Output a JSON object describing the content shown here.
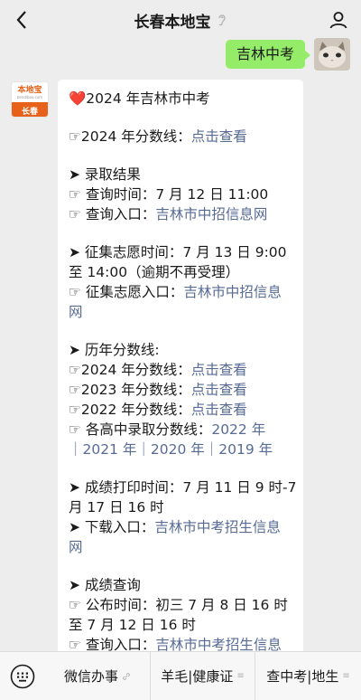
{
  "header": {
    "title": "长春本地宝"
  },
  "outgoing_message": {
    "text": "吉林中考"
  },
  "bot_avatar": {
    "logo_text": "本地宝",
    "logo_sub": "bendibao.com",
    "city": "长春"
  },
  "content": {
    "heading": "❤️2024 年吉林市中考",
    "score2024_label": "☞2024 年分数线：",
    "score2024_link": "点击查看",
    "admission_title": "➤ 录取结果",
    "query_time": "☞ 查询时间：7 月 12 日 11:00",
    "query_entry_label": "☞ 查询入口：",
    "query_entry_link": "吉林市中招信息网",
    "collect_line1": "➤ 征集志愿时间：7 月 13 日 9:00",
    "collect_line2": "至 14:00（逾期不再受理）",
    "collect_entry_label": "☞ 征集志愿入口：",
    "collect_entry_link1": "吉林市中招信息",
    "collect_entry_link2": "网",
    "history_title": "➤ 历年分数线:",
    "h2024_label": "☞2024 年分数线：",
    "h2024_link": "点击查看",
    "h2023_label": "☞2023 年分数线：",
    "h2023_link": "点击查看",
    "h2022_label": "☞2022 年分数线：",
    "h2022_link": "点击查看",
    "highschool_label": "☞ 各高中录取分数线：",
    "highschool_link1": "2022 年",
    "highschool_link2": "｜2021 年｜2020 年｜2019 年",
    "print_line1": "➤ 成绩打印时间：7 月 11 日 9 时-7",
    "print_line2": "月 17 日 16 时",
    "download_label": "➤ 下载入口：",
    "download_link1": "吉林市中考招生信息",
    "download_link2": "网",
    "result_title": "➤ 成绩查询",
    "publish_line1": "☞ 公布时间：初三 7 月 8 日 16 时",
    "publish_line2": "至 7 月 12 日 16 时",
    "result_entry_label": "☞ 查询入口：",
    "result_entry_link": "吉林市中考招生信息"
  },
  "bottom_menu": {
    "item1": "微信办事",
    "item2": "羊毛|健康证",
    "item3": "查中考|地生"
  },
  "colors": {
    "link": "#576b95",
    "outgoing_bubble": "#95ec69",
    "accent": "#e8611a"
  },
  "icons": [
    "back-chevron-icon",
    "ear-icon",
    "user-icon",
    "keyboard-icon",
    "menu-mark-icon"
  ]
}
